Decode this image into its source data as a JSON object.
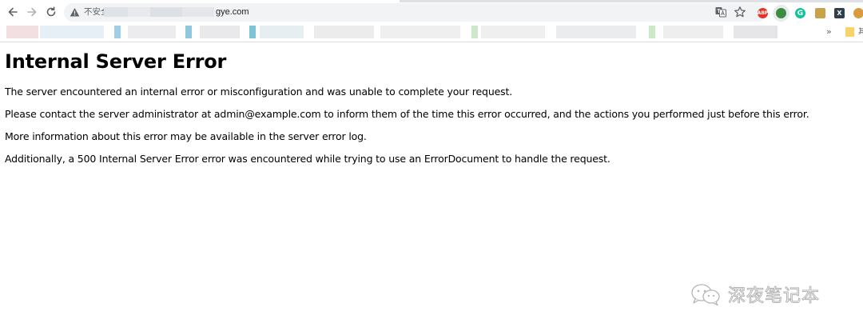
{
  "browser": {
    "security_label": "不安全",
    "url_visible": "gye.com",
    "bookmarks_folder_label": "其"
  },
  "page": {
    "heading": "Internal Server Error",
    "paragraphs": [
      "The server encountered an internal error or misconfiguration and was unable to complete your request.",
      "Please contact the server administrator at admin@example.com to inform them of the time this error occurred, and the actions you performed just before this error.",
      "More information about this error may be available in the server error log.",
      "Additionally, a 500 Internal Server Error error was encountered while trying to use an ErrorDocument to handle the request."
    ]
  },
  "watermark": {
    "text": "深夜笔记本"
  },
  "extensions": {
    "abp_label": "ABP",
    "grammarly_label": "G",
    "x_label": "X"
  },
  "colors": {
    "omnibox_bg": "#f1f3f4",
    "abp": "#e5332a",
    "grammarly": "#15c39a"
  }
}
